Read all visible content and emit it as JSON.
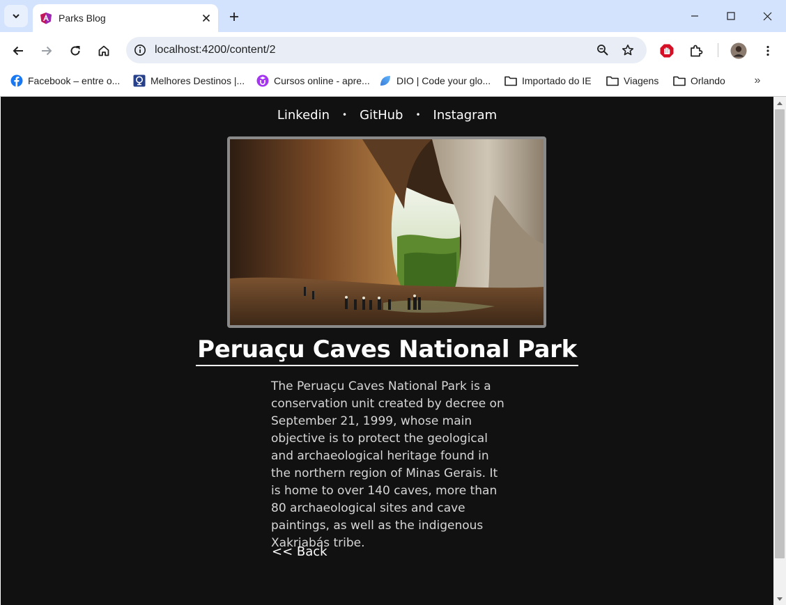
{
  "browser": {
    "tab": {
      "title": "Parks Blog"
    },
    "address": {
      "url": "localhost:4200/content/2"
    },
    "bookmarks": [
      {
        "label": "Facebook – entre o...",
        "icon": "facebook-icon"
      },
      {
        "label": "Melhores Destinos |...",
        "icon": "melhores-destinos-icon"
      },
      {
        "label": "Cursos online - apre...",
        "icon": "udemy-icon"
      },
      {
        "label": "DIO | Code your glo...",
        "icon": "dio-icon"
      },
      {
        "label": "Importado do IE",
        "icon": "folder-icon"
      },
      {
        "label": "Viagens",
        "icon": "folder-icon"
      },
      {
        "label": "Orlando",
        "icon": "folder-icon"
      }
    ],
    "bookmarks_more": "»"
  },
  "page": {
    "nav": {
      "links": [
        "Linkedin",
        "GitHub",
        "Instagram"
      ],
      "separator": "•"
    },
    "article": {
      "title": "Peruaçu Caves National Park",
      "body": "The Peruaçu Caves National Park is a conservation unit created by decree on September 21, 1999, whose main objective is to protect the geological and archaeological heritage found in the northern region of Minas Gerais. It is home to over 140 caves, more than 80 archaeological sites and cave paintings, as well as the indigenous Xakriabás tribe.",
      "back_label": "<< Back"
    }
  },
  "colors": {
    "tabstrip": "#d3e3fd",
    "page_background": "#111111",
    "text": "#ffffff",
    "body_text": "#d6d6d6",
    "image_border": "#8a8a8a"
  }
}
